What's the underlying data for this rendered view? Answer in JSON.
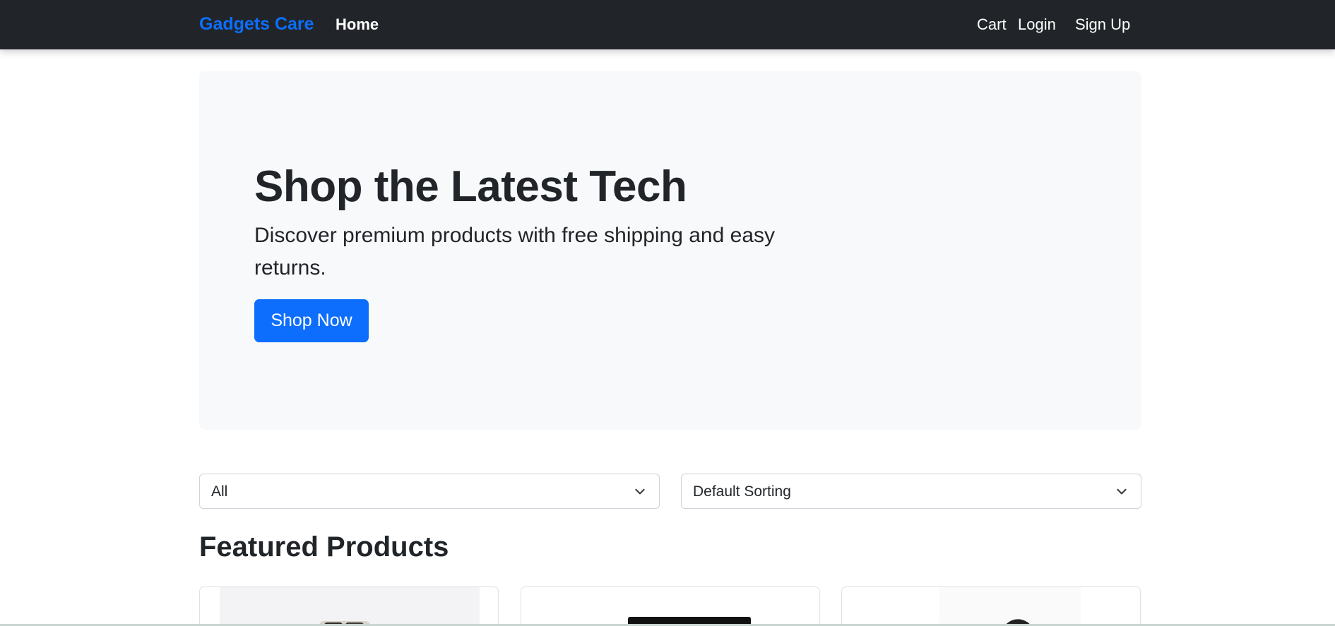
{
  "navbar": {
    "brand": "Gadgets Care",
    "home": "Home",
    "cart": "Cart",
    "login": "Login",
    "signup": "Sign Up"
  },
  "hero": {
    "title": "Shop the Latest Tech",
    "subtitle": "Discover premium products with free shipping and easy returns.",
    "button": "Shop Now"
  },
  "filters": {
    "category_value": "All",
    "sort_value": "Default Sorting"
  },
  "featured": {
    "title": "Featured Products"
  },
  "colors": {
    "navbar_bg": "#212529",
    "brand": "#0d6efd",
    "primary_button": "#0d6efd",
    "hero_bg": "#f8f9fa"
  }
}
